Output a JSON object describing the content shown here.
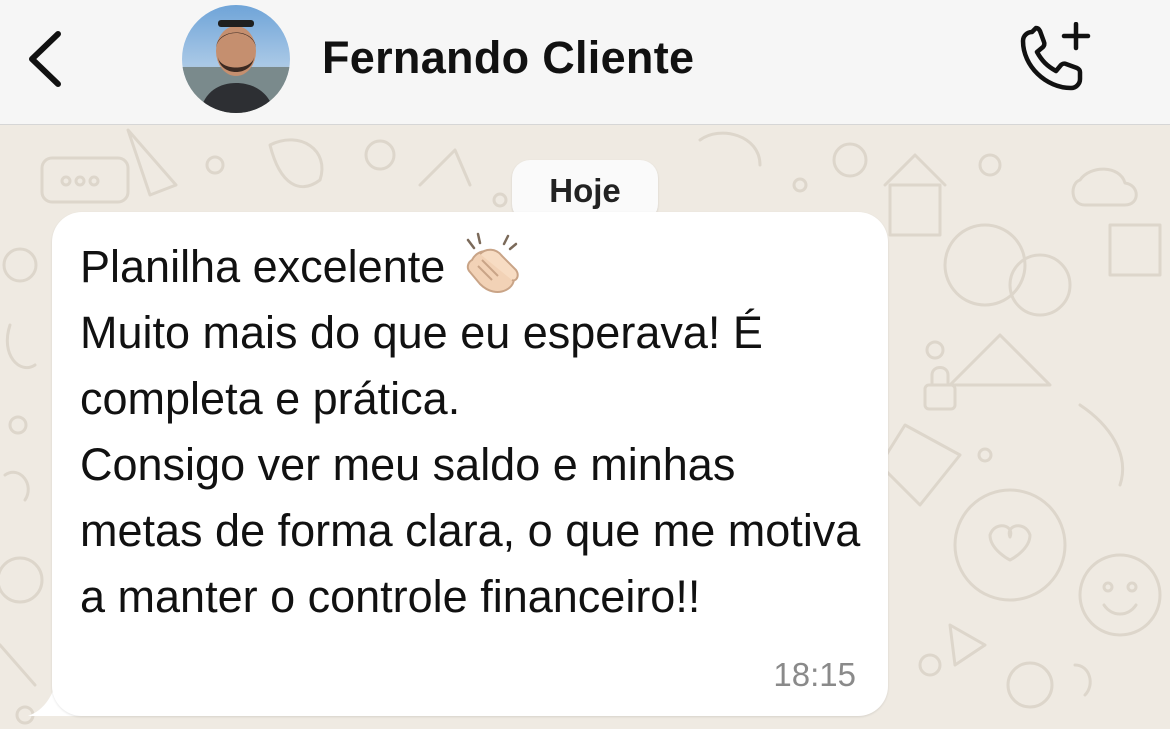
{
  "header": {
    "back_icon": "chevron-left-icon",
    "contact_name": "Fernando Cliente",
    "call_icon": "phone-add-icon",
    "background_color": "#f6f6f6"
  },
  "chat": {
    "wallpaper_color": "#efeae2",
    "date_divider": "Hoje",
    "messages": [
      {
        "direction": "incoming",
        "line_1": "Planilha excelente",
        "emoji_icon": "clapping-hands-icon",
        "body": "Muito mais do que eu esperava! É completa e prática.\nConsigo ver meu saldo e minhas metas de forma clara, o que me motiva a manter o controle financeiro!!",
        "time": "18:15"
      }
    ]
  }
}
